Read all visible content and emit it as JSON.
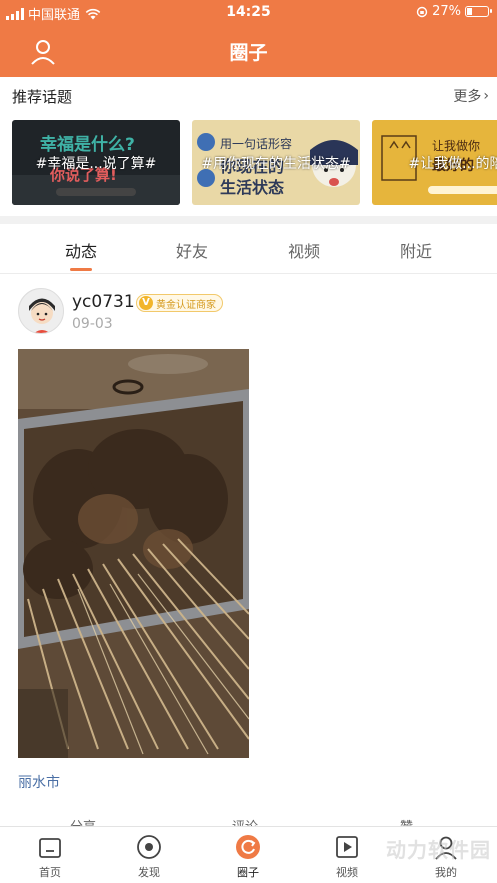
{
  "status_bar": {
    "carrier": "中国联通",
    "time": "14:25",
    "battery_percent": "27%",
    "battery_level": 0.27
  },
  "nav": {
    "title": "圈子",
    "user_icon": "user-icon"
  },
  "topics": {
    "title": "推荐话题",
    "more_label": "更多",
    "cards": [
      {
        "tag": "#幸福是...说了算#",
        "icon": "topic-image"
      },
      {
        "tag": "#用你现在的生活状态#",
        "icon": "topic-image"
      },
      {
        "tag": "#让我做...的陪",
        "icon": "topic-image"
      }
    ]
  },
  "tabs": [
    {
      "label": "动态",
      "active": true
    },
    {
      "label": "好友",
      "active": false
    },
    {
      "label": "视频",
      "active": false
    },
    {
      "label": "附近",
      "active": false
    }
  ],
  "post": {
    "username": "yc0731",
    "badge_letter": "V",
    "badge_text": "黄金认证商家",
    "date": "09-03",
    "location": "丽水市",
    "actions": [
      "分享",
      "评论",
      "赞"
    ]
  },
  "tabbar": [
    {
      "label": "首页",
      "icon": "home-icon",
      "active": false
    },
    {
      "label": "发现",
      "icon": "discover-icon",
      "active": false
    },
    {
      "label": "圈子",
      "icon": "circle-icon",
      "active": true
    },
    {
      "label": "视频",
      "icon": "video-icon",
      "active": false
    },
    {
      "label": "我的",
      "icon": "profile-icon",
      "active": false
    }
  ],
  "watermark": "动力软件园",
  "colors": {
    "accent": "#ef7a45",
    "link": "#4a6fa5",
    "badge": "#f2b52b"
  }
}
